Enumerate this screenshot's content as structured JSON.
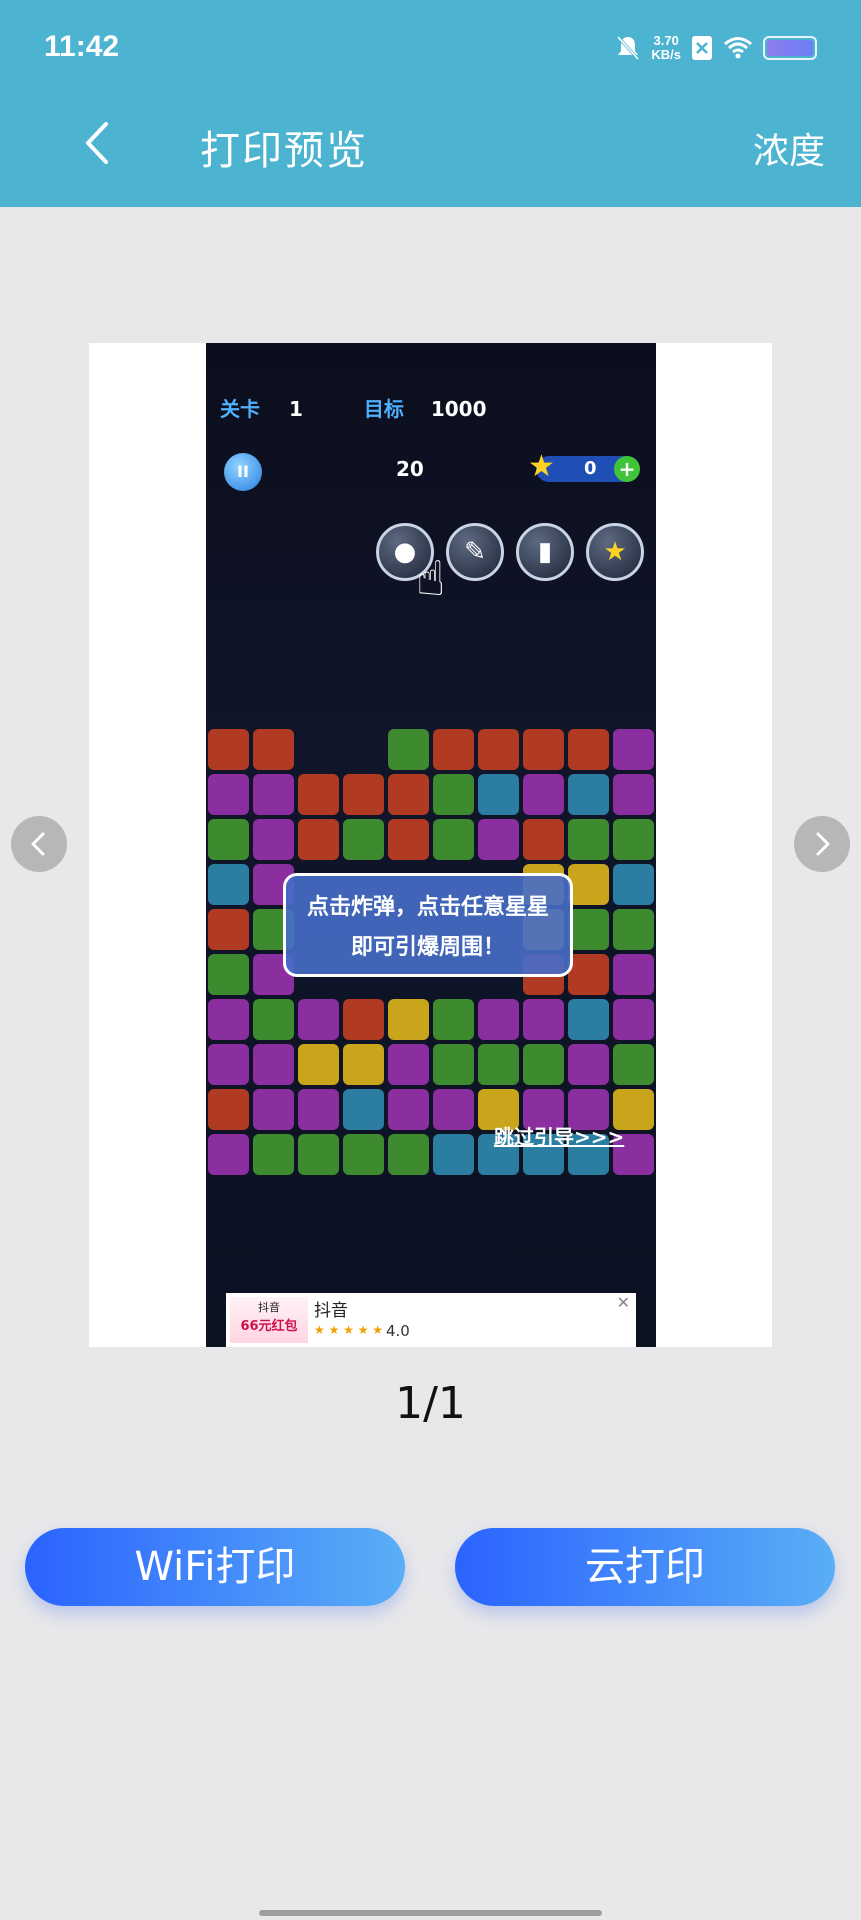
{
  "status_bar": {
    "time": "11:42",
    "net_speed_value": "3.70",
    "net_speed_unit": "KB/s",
    "icons": [
      "mute-icon",
      "sim-off-icon",
      "wifi-icon",
      "battery-icon"
    ]
  },
  "header": {
    "back_icon": "chevron-left-icon",
    "title": "打印预览",
    "right_action": "浓度"
  },
  "preview": {
    "game": {
      "level_label": "关卡",
      "level_value": "1",
      "target_label": "目标",
      "target_value": "1000",
      "moves": "20",
      "coins": "0",
      "hint_line1": "点击炸弹，点击任意星星",
      "hint_line2": "即可引爆周围！",
      "skip_text": "跳过引导>>>",
      "tools": [
        "bomb-icon",
        "brush-icon",
        "battery-icon",
        "star-icon"
      ],
      "grid_rows": [
        "rr..grrrrp",
        "pprrrgbpbp",
        "gprgrgprgg",
        "bp.....yyb",
        "rg.....ygg",
        "gp.....rrp",
        "pgprygppbp",
        "ppyypgggpg",
        "rppbppyppy",
        "pggggbbbbp"
      ]
    },
    "ad": {
      "thumb_brand": "抖音",
      "thumb_promo": "66元红包",
      "app_name": "抖音",
      "rating": "4.0",
      "close_icon": "close-icon"
    }
  },
  "pager": {
    "indicator": "1/1",
    "prev_icon": "chevron-left-icon",
    "next_icon": "chevron-right-icon"
  },
  "actions": {
    "wifi_print": "WiFi打印",
    "cloud_print": "云打印"
  },
  "colors": {
    "header_bg": "#4cb3d1",
    "button_gradient_start": "#2b63ff",
    "button_gradient_end": "#5aaef6"
  }
}
